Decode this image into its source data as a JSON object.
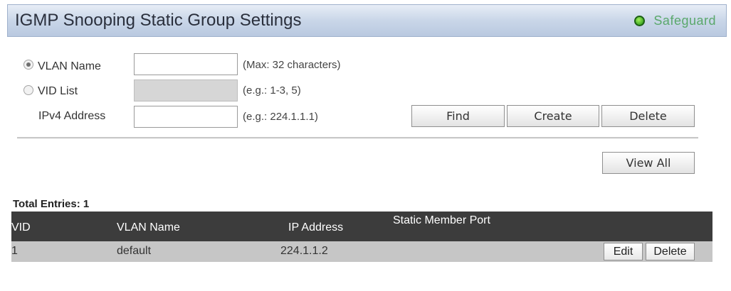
{
  "header": {
    "title": "IGMP Snooping Static Group Settings",
    "safeguard_label": "Safeguard"
  },
  "form": {
    "vlan_name": {
      "label": "VLAN Name",
      "selected": true,
      "value": "",
      "hint": "(Max: 32 characters)"
    },
    "vid_list": {
      "label": "VID List",
      "selected": false,
      "value": "",
      "hint": "(e.g.: 1-3, 5)"
    },
    "ipv4_address": {
      "label": "IPv4 Address",
      "value": "",
      "hint": "(e.g.: 224.1.1.1)"
    },
    "buttons": {
      "find": "Find",
      "create": "Create",
      "delete": "Delete",
      "view_all": "View All"
    }
  },
  "table": {
    "total_entries": "Total Entries: 1",
    "columns": {
      "vid": "VID",
      "vlan_name": "VLAN Name",
      "ip_address": "IP Address",
      "static_member_port": "Static Member Port"
    },
    "rows": [
      {
        "vid": "1",
        "vlan_name": "default",
        "ip_address": "224.1.1.2",
        "static_member_port": "",
        "edit": "Edit",
        "delete": "Delete"
      }
    ]
  },
  "colors": {
    "title_bar": "#c9d6e8",
    "table_header": "#3c3c3c",
    "table_row": "#c6c6c6",
    "safeguard_text": "#5aa86b",
    "safeguard_dot": "#1e8f13"
  }
}
